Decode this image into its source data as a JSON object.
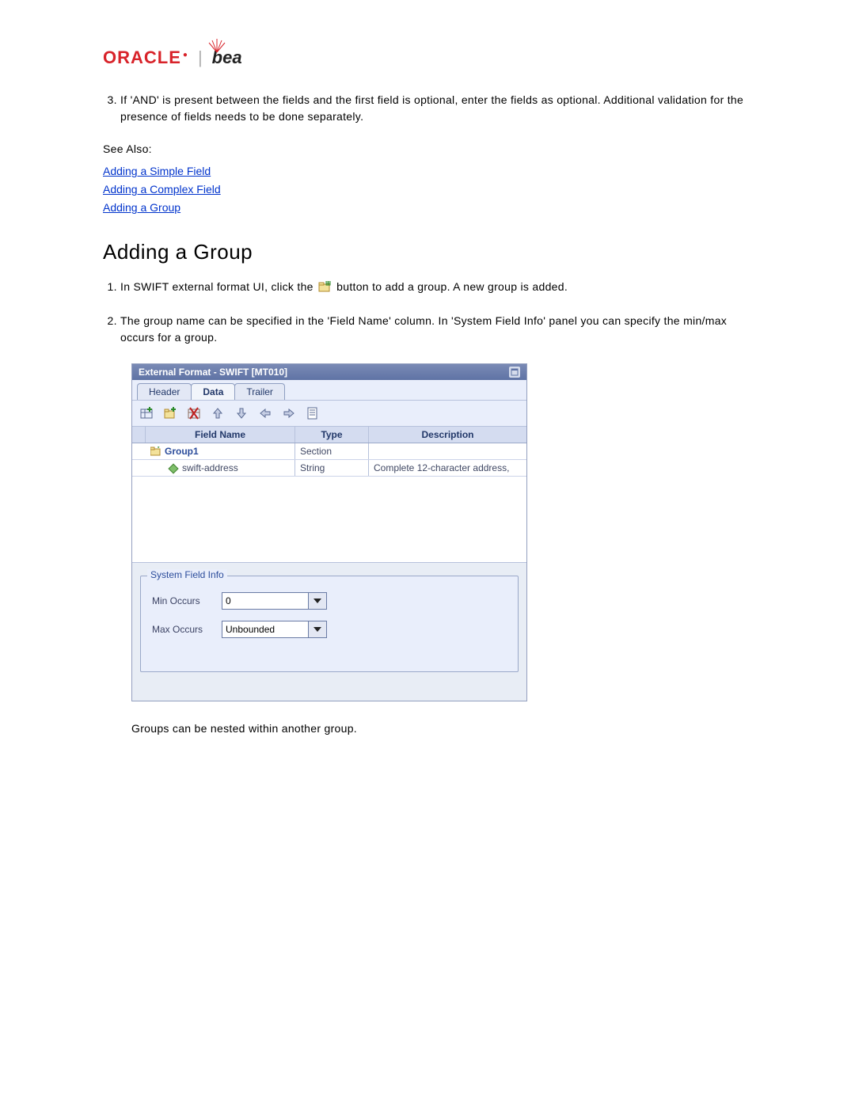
{
  "logos": {
    "oracle": "ORACLE",
    "divider": "|",
    "bea": "bea"
  },
  "intro_step3": "If 'AND' is present between the fields and the first field is optional, enter the fields as optional. Additional validation for the presence of fields needs to be done separately.",
  "see_also_label": "See Also:",
  "see_also_links": {
    "simple": "Adding a Simple Field",
    "complex": "Adding a Complex Field",
    "group": "Adding a Group"
  },
  "heading": "Adding a Group",
  "group_steps": {
    "s1_a": "In SWIFT external format UI, click the ",
    "s1_b": " button to add a group. A new group is added.",
    "s2": "The group name can be specified in the 'Field Name' column. In 'System Field Info' panel you can specify the min/max occurs for a group."
  },
  "panel": {
    "title": "External Format - SWIFT [MT010]",
    "tabs": {
      "header": "Header",
      "data": "Data",
      "trailer": "Trailer"
    },
    "columns": {
      "name": "Field Name",
      "type": "Type",
      "desc": "Description"
    },
    "rows": [
      {
        "name": "Group1",
        "type": "Section",
        "desc": "",
        "kind": "group"
      },
      {
        "name": "swift-address",
        "type": "String",
        "desc": "Complete 12-character address,",
        "kind": "field"
      }
    ],
    "sys_legend": "System Field Info",
    "min_label": "Min Occurs",
    "max_label": "Max Occurs",
    "min_value": "0",
    "max_value": "Unbounded"
  },
  "closing": "Groups can be nested within another group."
}
